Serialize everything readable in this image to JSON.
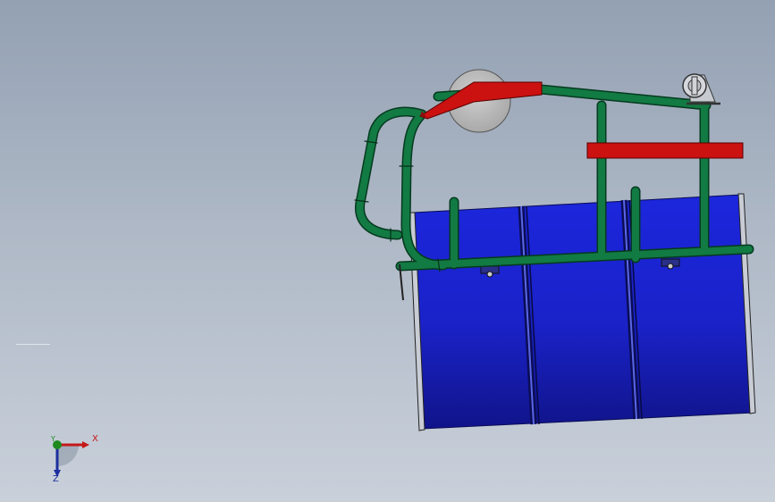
{
  "viewport": {
    "background_top": "#93a1b3",
    "background_bottom": "#c9d0da"
  },
  "model": {
    "drum_color": "#1a22d6",
    "frame_color": "#116b3d",
    "bracket_color": "#cc1111",
    "wheel_color": "#b9b9b9",
    "caster_color": "#c7cbd1"
  },
  "triad": {
    "x_label": "X",
    "y_label": "Y",
    "z_label": "Z",
    "x_color": "#c41818",
    "y_color": "#1e8a1e",
    "z_color": "#1b2f9e"
  }
}
